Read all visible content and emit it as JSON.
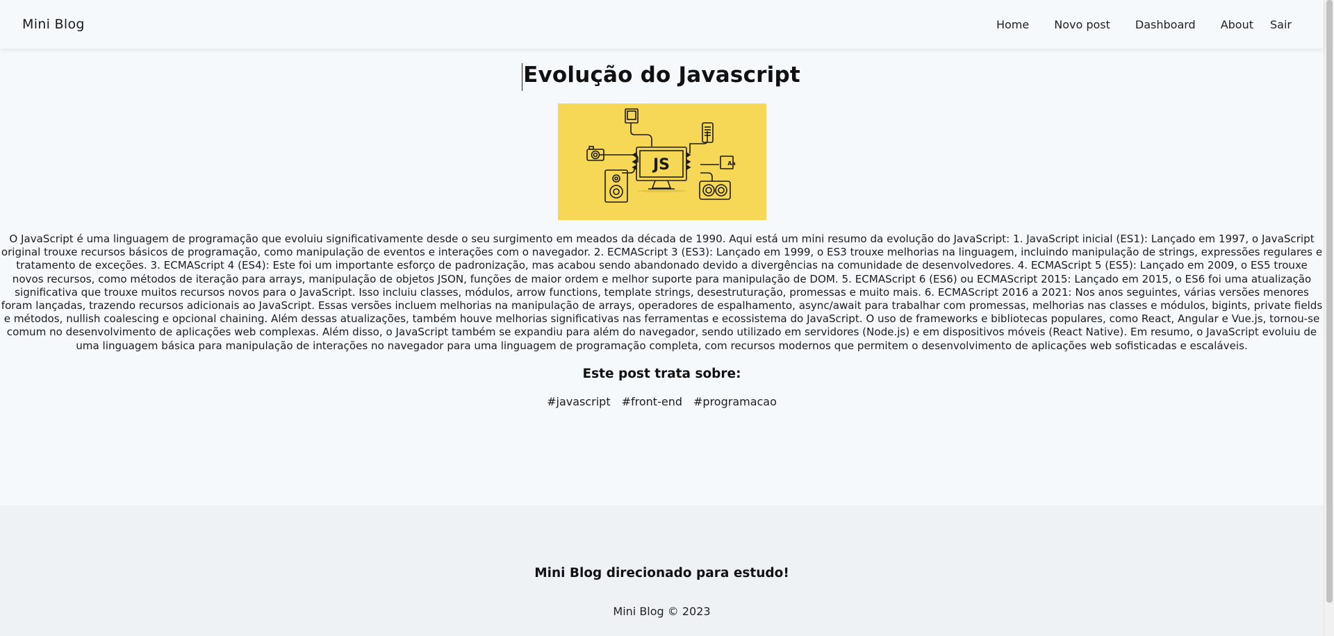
{
  "navbar": {
    "brand": "Mini Blog",
    "links": [
      "Home",
      "Novo post",
      "Dashboard",
      "About"
    ],
    "logout_label": "Sair"
  },
  "post": {
    "title": "Evolução do Javascript",
    "image_text": "JS",
    "body": "O JavaScript é uma linguagem de programação que evoluiu significativamente desde o seu surgimento em meados da década de 1990. Aqui está um mini resumo da evolução do JavaScript: 1. JavaScript inicial (ES1): Lançado em 1997, o JavaScript original trouxe recursos básicos de programação, como manipulação de eventos e interações com o navegador. 2. ECMAScript 3 (ES3): Lançado em 1999, o ES3 trouxe melhorias na linguagem, incluindo manipulação de strings, expressões regulares e tratamento de exceções. 3. ECMAScript 4 (ES4): Este foi um importante esforço de padronização, mas acabou sendo abandonado devido a divergências na comunidade de desenvolvedores. 4. ECMAScript 5 (ES5): Lançado em 2009, o ES5 trouxe novos recursos, como métodos de iteração para arrays, manipulação de objetos JSON, funções de maior ordem e melhor suporte para manipulação de DOM. 5. ECMAScript 6 (ES6) ou ECMAScript 2015: Lançado em 2015, o ES6 foi uma atualização significativa que trouxe muitos recursos novos para o JavaScript. Isso incluiu classes, módulos, arrow functions, template strings, desestruturação, promessas e muito mais. 6. ECMAScript 2016 a 2021: Nos anos seguintes, várias versões menores foram lançadas, trazendo recursos adicionais ao JavaScript. Essas versões incluem melhorias na manipulação de arrays, operadores de espalhamento, async/await para trabalhar com promessas, melhorias nas classes e módulos, bigints, private fields e métodos, nullish coalescing e opcional chaining. Além dessas atualizações, também houve melhorias significativas nas ferramentas e ecossistema do JavaScript. O uso de frameworks e bibliotecas populares, como React, Angular e Vue.js, tornou-se comum no desenvolvimento de aplicações web complexas. Além disso, o JavaScript também se expandiu para além do navegador, sendo utilizado em servidores (Node.js) e em dispositivos móveis (React Native). Em resumo, o JavaScript evoluiu de uma linguagem básica para manipulação de interações no navegador para uma linguagem de programação completa, com recursos modernos que permitem o desenvolvimento de aplicações web sofisticadas e escaláveis.",
    "tags_heading": "Este post trata sobre:",
    "tags": [
      "#javascript",
      "#front-end",
      "#programacao"
    ]
  },
  "footer": {
    "title": "Mini Blog direcionado para estudo!",
    "copyright": "Mini Blog © 2023"
  },
  "colors": {
    "page_background": "#f5f9fc",
    "footer_background": "#eef2f5",
    "hero_background": "#f6d856"
  }
}
